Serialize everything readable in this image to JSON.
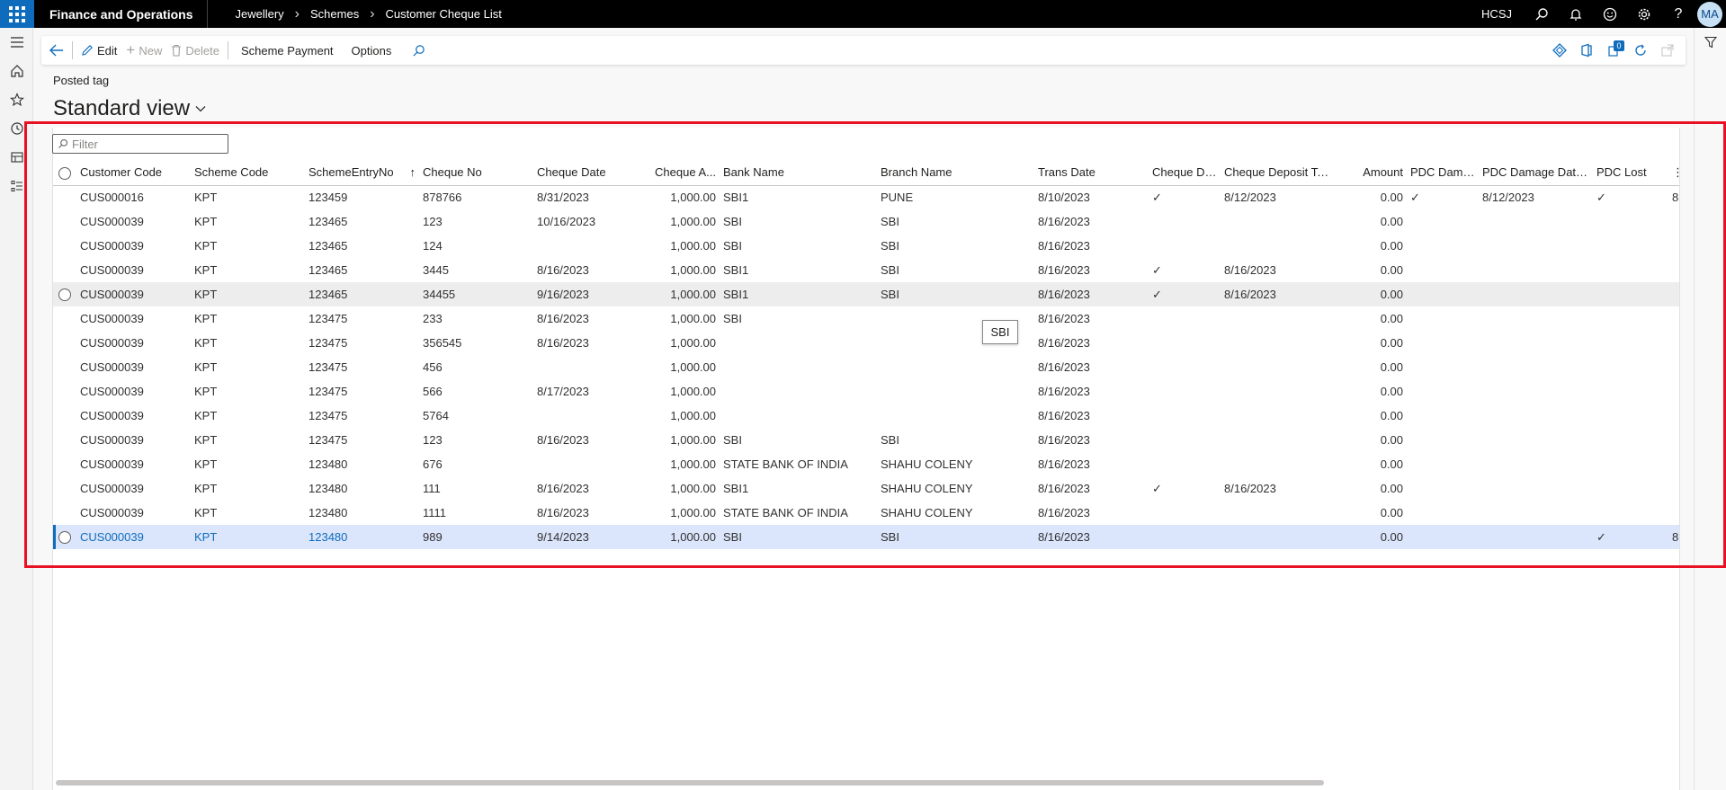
{
  "topbar": {
    "app_title": "Finance and Operations",
    "breadcrumb": [
      "Jewellery",
      "Schemes",
      "Customer Cheque List"
    ],
    "company": "HCSJ",
    "avatar_initials": "MA"
  },
  "actionpane": {
    "edit": "Edit",
    "new": "New",
    "delete": "Delete",
    "scheme_payment": "Scheme Payment",
    "options": "Options",
    "badge_count": "0"
  },
  "page": {
    "posted_tag": "Posted tag",
    "view_name": "Standard view"
  },
  "filter": {
    "placeholder": "Filter"
  },
  "grid": {
    "columns": [
      "Customer Code",
      "Scheme Code",
      "SchemeEntryNo",
      "Cheque No",
      "Cheque Date",
      "Cheque A...",
      "Bank Name",
      "Branch Name",
      "Trans Date",
      "Cheque De...",
      "Cheque Deposit To ...",
      "Amount",
      "PDC Dama...",
      "PDC Damage Date ...",
      "PDC Lost"
    ],
    "sort_indicator": "↑",
    "rows": [
      [
        "CUS000016",
        "KPT",
        "123459",
        "878766",
        "8/31/2023",
        "1,000.00",
        "SBI1",
        "PUNE",
        "8/10/2023",
        "✓",
        "8/12/2023",
        "0.00",
        "✓",
        "8/12/2023",
        "✓"
      ],
      [
        "CUS000039",
        "KPT",
        "123465",
        "123",
        "10/16/2023",
        "1,000.00",
        "SBI",
        "SBI",
        "8/16/2023",
        "",
        "",
        "0.00",
        "",
        "",
        ""
      ],
      [
        "CUS000039",
        "KPT",
        "123465",
        "124",
        "",
        "1,000.00",
        "SBI",
        "SBI",
        "8/16/2023",
        "",
        "",
        "0.00",
        "",
        "",
        ""
      ],
      [
        "CUS000039",
        "KPT",
        "123465",
        "3445",
        "8/16/2023",
        "1,000.00",
        "SBI1",
        "SBI",
        "8/16/2023",
        "✓",
        "8/16/2023",
        "0.00",
        "",
        "",
        ""
      ],
      [
        "CUS000039",
        "KPT",
        "123465",
        "34455",
        "9/16/2023",
        "1,000.00",
        "SBI1",
        "SBI",
        "8/16/2023",
        "✓",
        "8/16/2023",
        "0.00",
        "",
        "",
        ""
      ],
      [
        "CUS000039",
        "KPT",
        "123475",
        "233",
        "8/16/2023",
        "1,000.00",
        "SBI",
        "",
        "8/16/2023",
        "",
        "",
        "0.00",
        "",
        "",
        ""
      ],
      [
        "CUS000039",
        "KPT",
        "123475",
        "356545",
        "8/16/2023",
        "1,000.00",
        "",
        "",
        "8/16/2023",
        "",
        "",
        "0.00",
        "",
        "",
        ""
      ],
      [
        "CUS000039",
        "KPT",
        "123475",
        "456",
        "",
        "1,000.00",
        "",
        "",
        "8/16/2023",
        "",
        "",
        "0.00",
        "",
        "",
        ""
      ],
      [
        "CUS000039",
        "KPT",
        "123475",
        "566",
        "8/17/2023",
        "1,000.00",
        "",
        "",
        "8/16/2023",
        "",
        "",
        "0.00",
        "",
        "",
        ""
      ],
      [
        "CUS000039",
        "KPT",
        "123475",
        "5764",
        "",
        "1,000.00",
        "",
        "",
        "8/16/2023",
        "",
        "",
        "0.00",
        "",
        "",
        ""
      ],
      [
        "CUS000039",
        "KPT",
        "123475",
        "123",
        "8/16/2023",
        "1,000.00",
        "SBI",
        "SBI",
        "8/16/2023",
        "",
        "",
        "0.00",
        "",
        "",
        ""
      ],
      [
        "CUS000039",
        "KPT",
        "123480",
        "676",
        "",
        "1,000.00",
        "STATE BANK OF INDIA",
        "SHAHU COLENY",
        "8/16/2023",
        "",
        "",
        "0.00",
        "",
        "",
        ""
      ],
      [
        "CUS000039",
        "KPT",
        "123480",
        "111",
        "8/16/2023",
        "1,000.00",
        "SBI1",
        "SHAHU COLENY",
        "8/16/2023",
        "✓",
        "8/16/2023",
        "0.00",
        "",
        "",
        ""
      ],
      [
        "CUS000039",
        "KPT",
        "123480",
        "1111",
        "8/16/2023",
        "1,000.00",
        "STATE BANK OF INDIA",
        "SHAHU COLENY",
        "8/16/2023",
        "",
        "",
        "0.00",
        "",
        "",
        ""
      ],
      [
        "CUS000039",
        "KPT",
        "123480",
        "989",
        "9/14/2023",
        "1,000.00",
        "SBI",
        "SBI",
        "8/16/2023",
        "",
        "",
        "0.00",
        "",
        "",
        "✓"
      ]
    ],
    "overflow_glyph": "8",
    "hover_row_index": 4,
    "selected_row_index": 14
  },
  "tooltip": {
    "text": "SBI"
  },
  "colors": {
    "accent": "#0f6cbd",
    "highlight_box": "#e81123",
    "selected_row": "#dbe5fb"
  }
}
